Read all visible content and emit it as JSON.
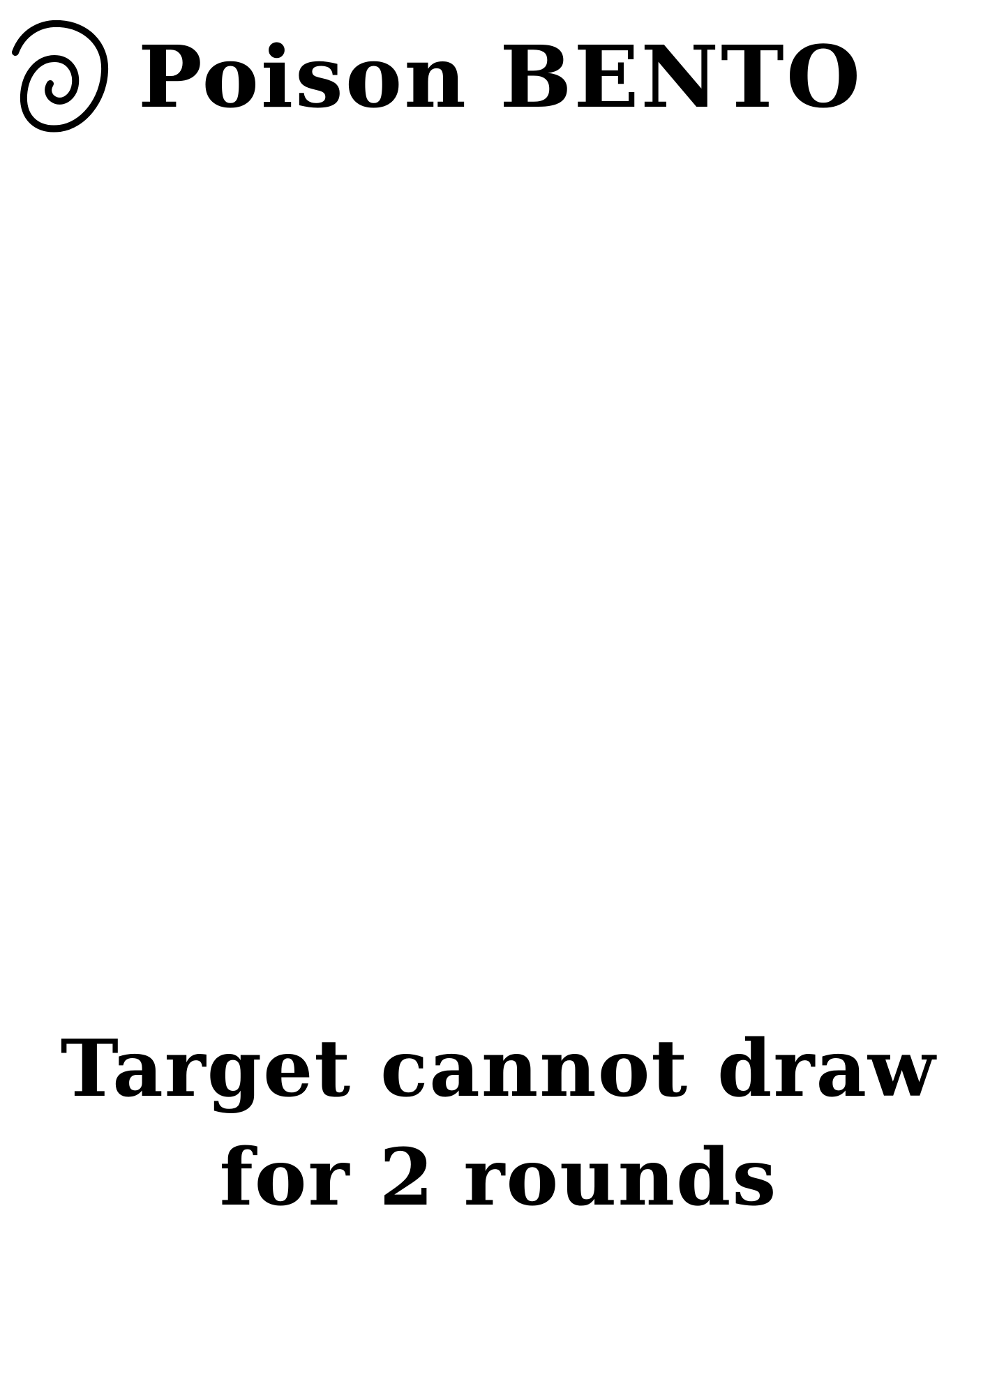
{
  "card": {
    "icon": "spiral-icon",
    "title": "Poison BENTO",
    "effect_text": "Target cannot draw for 2 rounds"
  },
  "colors": {
    "background": "#ffffff",
    "ink": "#000000"
  }
}
